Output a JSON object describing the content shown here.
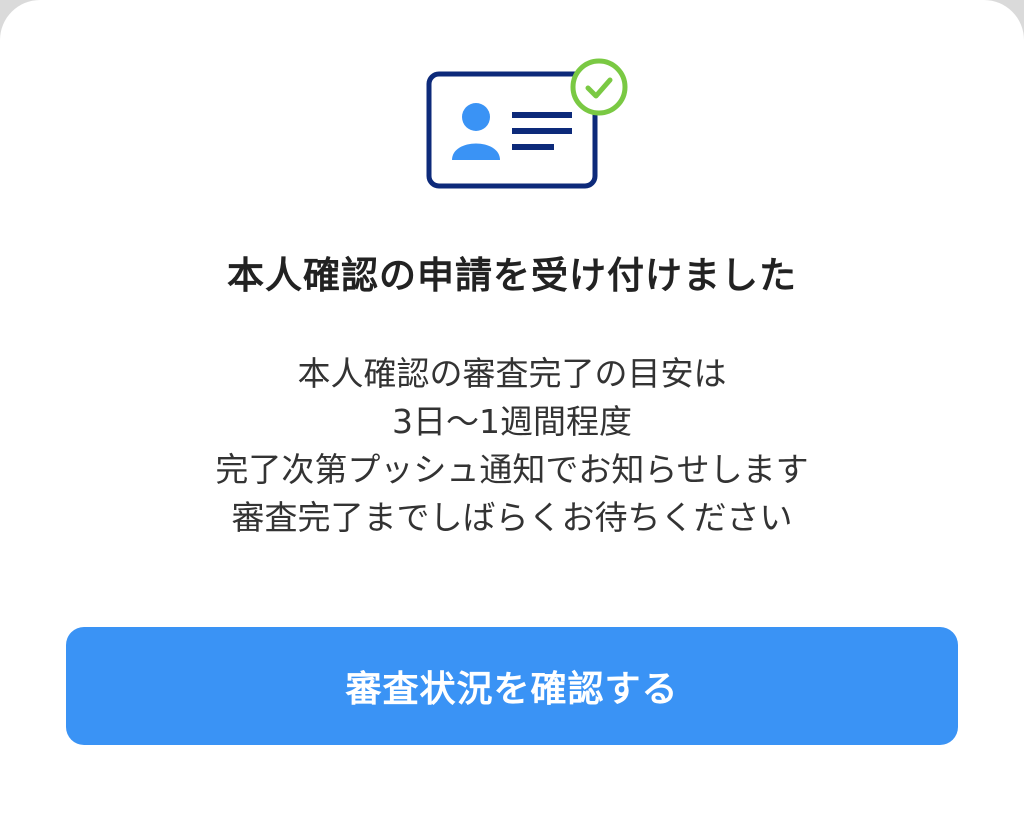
{
  "dialog": {
    "illustration_icon": "id-card-check-icon",
    "title": "本人確認の申請を受け付けました",
    "message_lines": [
      "本人確認の審査完了の目安は",
      "3日〜1週間程度",
      "完了次第プッシュ通知でお知らせします",
      "審査完了までしばらくお待ちください"
    ],
    "primary_button_label": "審査状況を確認する"
  },
  "colors": {
    "accent": "#3a93f5",
    "card_border": "#0d2a7a",
    "check_green": "#7ac943",
    "title_text": "#222222",
    "body_text": "#333333"
  }
}
